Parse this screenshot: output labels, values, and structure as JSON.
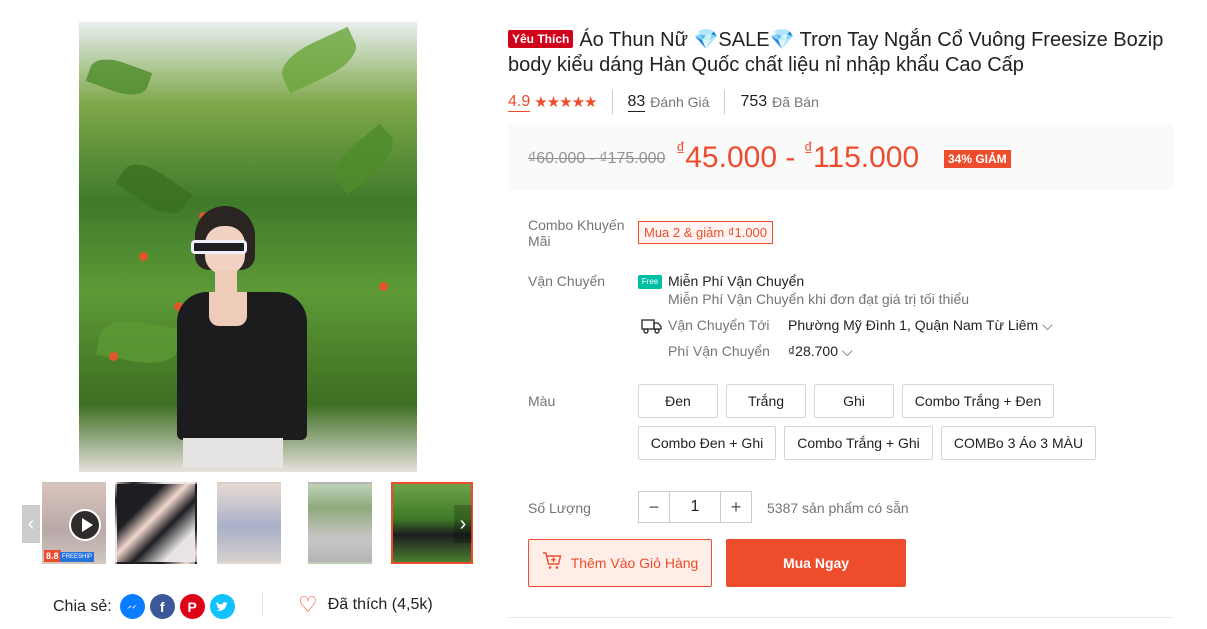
{
  "gallery": {
    "share_label": "Chia sẻ:",
    "share_icons": [
      "messenger-icon",
      "facebook-icon",
      "pinterest-icon",
      "twitter-icon"
    ],
    "like_label": "Đã thích (4,5k)",
    "badge_text": "8.8",
    "badge_sub": "FREESHIP"
  },
  "product": {
    "fav_tag": "Yêu Thích",
    "title": "Áo Thun Nữ 💎SALE💎 Trơn Tay Ngắn Cổ Vuông Freesize Bozip body kiểu dáng Hàn Quốc chất liệu nỉ nhập khẩu Cao Cấp",
    "rating": "4.9",
    "stars": "★★★★★",
    "rating_count": "83",
    "rating_label": "Đánh Giá",
    "sold_count": "753",
    "sold_label": "Đã Bán"
  },
  "price": {
    "old": "₫60.000 - ₫175.000",
    "currency": "₫",
    "new_min": "45.000",
    "new_max": "115.000",
    "separator": "-",
    "discount": "34% GIẢM"
  },
  "combo": {
    "label": "Combo Khuyến Mãi",
    "tag": "Mua 2 & giảm ₫1.000"
  },
  "shipping": {
    "label": "Vận Chuyển",
    "free_icon_text": "Free",
    "free_title": "Miễn Phí Vận Chuyển",
    "free_sub": "Miễn Phí Vận Chuyển khi đơn đạt giá trị tối thiểu",
    "to_label": "Vận Chuyển Tới",
    "to_value": "Phường Mỹ Đình 1, Quận Nam Từ Liêm",
    "fee_label": "Phí Vận Chuyển",
    "fee_value": "₫28.700"
  },
  "color": {
    "label": "Màu",
    "options": [
      "Đen",
      "Trắng",
      "Ghi",
      "Combo Trắng + Đen",
      "Combo Đen + Ghi",
      "Combo Trắng + Ghi",
      "COMBo 3 Áo 3 MÀU"
    ]
  },
  "quantity": {
    "label": "Số Lượng",
    "value": "1",
    "minus": "−",
    "plus": "+",
    "stock": "5387 sản phẩm có sẵn"
  },
  "actions": {
    "add_to_cart": "Thêm Vào Giỏ Hàng",
    "buy_now": "Mua Ngay"
  },
  "colors": {
    "accent": "#ee4d2d",
    "fav": "#d0011b",
    "free": "#00bfa5"
  }
}
